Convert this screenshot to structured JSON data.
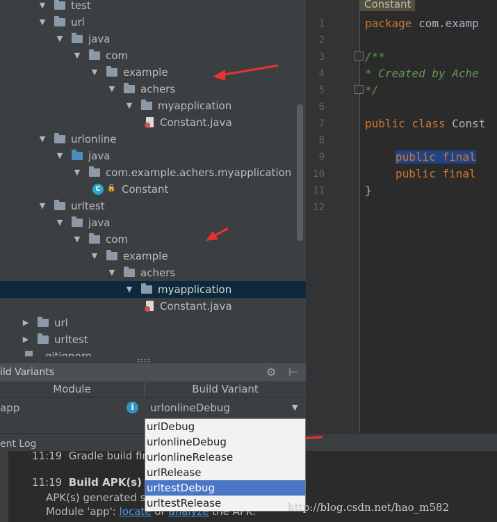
{
  "project_tree": {
    "items": [
      {
        "label": "test",
        "depth": 0,
        "icon": "folder"
      },
      {
        "label": "url",
        "depth": 0,
        "icon": "folder"
      },
      {
        "label": "java",
        "depth": 1,
        "icon": "folder"
      },
      {
        "label": "com",
        "depth": 2,
        "icon": "folder"
      },
      {
        "label": "example",
        "depth": 3,
        "icon": "folder"
      },
      {
        "label": "achers",
        "depth": 4,
        "icon": "folder"
      },
      {
        "label": "myapplication",
        "depth": 5,
        "icon": "folder"
      },
      {
        "label": "Constant.java",
        "depth": 6,
        "icon": "java-file"
      },
      {
        "label": "urlonline",
        "depth": 0,
        "icon": "folder"
      },
      {
        "label": "java",
        "depth": 1,
        "icon": "source-folder"
      },
      {
        "label": "com.example.achers.myapplication",
        "depth": 2,
        "icon": "package"
      },
      {
        "label": "Constant",
        "depth": 3,
        "icon": "class"
      },
      {
        "label": "urltest",
        "depth": 0,
        "icon": "folder"
      },
      {
        "label": "java",
        "depth": 1,
        "icon": "folder"
      },
      {
        "label": "com",
        "depth": 2,
        "icon": "folder"
      },
      {
        "label": "example",
        "depth": 3,
        "icon": "folder"
      },
      {
        "label": "achers",
        "depth": 4,
        "icon": "folder"
      },
      {
        "label": "myapplication",
        "depth": 5,
        "icon": "folder"
      },
      {
        "label": "Constant.java",
        "depth": 6,
        "icon": "java-file"
      },
      {
        "label": "url",
        "depth": -1,
        "icon": "folder"
      },
      {
        "label": "urltest",
        "depth": -1,
        "icon": "folder"
      },
      {
        "label": ".gitignore",
        "depth": -1,
        "icon": "file"
      }
    ]
  },
  "editor": {
    "tab_hint": "Constant",
    "line_numbers": [
      "1",
      "2",
      "3",
      "4",
      "5",
      "6",
      "7",
      "8",
      "9",
      "10",
      "11",
      "12"
    ],
    "line1_kw": "package",
    "line1_rest": " com.examp",
    "line3": "/**",
    "line4": " * Created by Ache",
    "line5": " */",
    "line7_kw": "public class",
    "line7_rest": " Const",
    "line9_kw": "public final",
    "line10_kw": "public final",
    "line11": "}"
  },
  "build_variants": {
    "title": "ild Variants",
    "col_module": "Module",
    "col_variant": "Build Variant",
    "module": "app",
    "selected_variant": "urlonlineDebug",
    "options": [
      "urlDebug",
      "urlonlineDebug",
      "urlonlineRelease",
      "urlRelease",
      "urltestDebug",
      "urltestRelease"
    ],
    "highlighted_option": 4
  },
  "event_log": {
    "title": "ent Log",
    "e1_time": "11:19",
    "e1_text": "Gradle build finished",
    "e2_time": "11:19",
    "e2_title": "Build APK(s)",
    "e2_line1": "APK(s) generated su",
    "e2_line2_a": "Module 'app': ",
    "e2_link1": "locate",
    "e2_mid": " or ",
    "e2_link2": "analyze",
    "e2_tail": " the APK."
  },
  "watermark": "http://blog.csdn.net/hao_m582",
  "colors": {
    "annotation_arrow": "#e8322f",
    "selection": "#0d293e",
    "dropdown_highlight": "#4a76c6"
  }
}
